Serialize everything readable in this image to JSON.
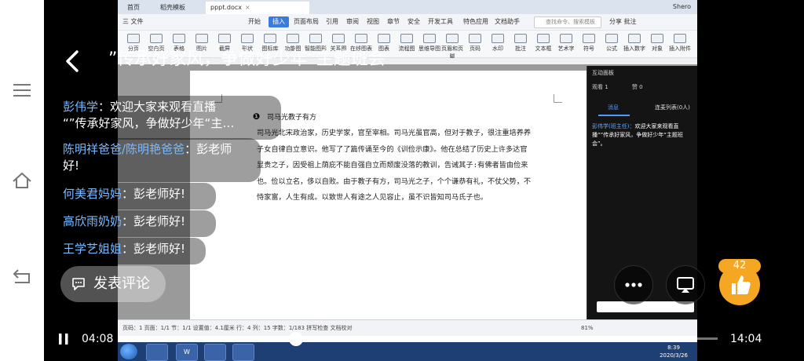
{
  "stream": {
    "title": "”传承好家风，争做好少年“主题班会"
  },
  "comments": [
    {
      "user": "彭伟学",
      "sep": "：",
      "text": "欢迎大家来观看直播",
      "text2": "“”传承好家风，争做好少年“主…"
    },
    {
      "user": "陈明祥爸爸/陈明艳爸爸",
      "sep": "：",
      "text": "彭老师",
      "text2": "好!"
    },
    {
      "user": "何美君妈妈",
      "sep": "：",
      "text": "彭老师好!"
    },
    {
      "user": "高欣雨奶奶",
      "sep": "：",
      "text": "彭老师好!"
    },
    {
      "user": "王学艺姐姐",
      "sep": "：",
      "text": "彭老师好!"
    }
  ],
  "comment_button": {
    "label": "发表评论"
  },
  "like": {
    "count": "42"
  },
  "player": {
    "current_time": "04:08",
    "total_time": "14:04",
    "progress": 0.294
  },
  "screen": {
    "tabs": [
      {
        "label": "首页"
      },
      {
        "label": "稻壳模板"
      },
      {
        "label": "pppt.docx"
      }
    ],
    "title_right": "Shero",
    "menu": [
      {
        "label": "三 文件"
      },
      {
        "label": "开始"
      },
      {
        "label": "插入"
      },
      {
        "label": "页面布局"
      },
      {
        "label": "引用"
      },
      {
        "label": "审阅"
      },
      {
        "label": "视图"
      },
      {
        "label": "章节"
      },
      {
        "label": "安全"
      },
      {
        "label": "开发工具"
      },
      {
        "label": "特色应用"
      },
      {
        "label": "文档助手"
      }
    ],
    "search_placeholder": "查找命令、搜索模板",
    "menu_right": "分享  批注",
    "toolbar": [
      {
        "label": "分页"
      },
      {
        "label": "空白页"
      },
      {
        "label": "表格"
      },
      {
        "label": "图片"
      },
      {
        "label": "截屏"
      },
      {
        "label": "形状"
      },
      {
        "label": "图标库"
      },
      {
        "label": "功能图"
      },
      {
        "label": "智能图形"
      },
      {
        "label": "关系图"
      },
      {
        "label": "在线图表"
      },
      {
        "label": "图表"
      },
      {
        "label": "流程图"
      },
      {
        "label": "思维导图"
      },
      {
        "label": "页眉和页脚"
      },
      {
        "label": "页码"
      },
      {
        "label": "水印"
      },
      {
        "label": "批注"
      },
      {
        "label": "文本框"
      },
      {
        "label": "艺术字"
      },
      {
        "label": "符号"
      },
      {
        "label": "公式"
      },
      {
        "label": "插入数字"
      },
      {
        "label": "对象"
      },
      {
        "label": "插入附件"
      }
    ],
    "doc": {
      "title": "司马光教子有方",
      "para": "司马光北宋政治家，历史学家，官至宰相。司马光虽官高，但对于教子，很注重培养养子女自律自立意识。他写了了篇传诵至今的《训俭示康》。他在总结了历史上许多达官显贵之子，因受祖上荫庇不能自强自立而颓废没落的教训，告诫其子:有佛者皆由俭来也。俭以立名，侈以自败。由于教子有方，司马光之子，个个谦恭有礼，不仗父势，不恃家富，人生有成。以致世人有途之人见容止，虽不识皆知司马氏子也。"
    },
    "status": "页码：1  页面：1/1  节：1/1  设置值：4.1厘米  行：4  列：15  字数：1/183  拼写检查  文档校对",
    "zoom": "81%",
    "panel": {
      "title": "互动面板",
      "viewers": "观看 1",
      "likes": "赞 0",
      "tab_msg": "消息",
      "tab_list": "连麦列表(0人)",
      "msg_user": "彭伟学(班主任)：",
      "msg_text": "欢迎大家来观看直播“”传承好家风，争做好少年“主题班会”。"
    },
    "clock_time": "8:39",
    "clock_date": "2020/3/26"
  },
  "colors": {
    "accent": "#f5a623",
    "username": "#78bbff",
    "panel_link": "#4c9bff"
  }
}
